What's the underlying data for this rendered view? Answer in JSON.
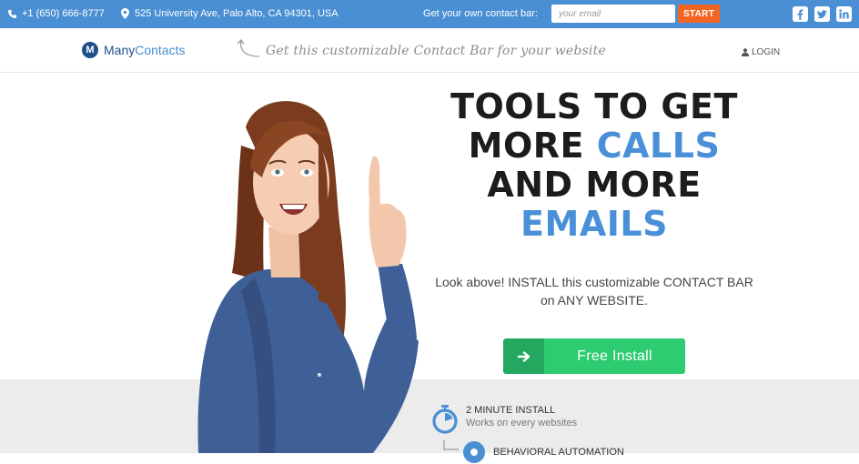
{
  "contact_bar": {
    "phone": "+1 (650) 666-8777",
    "address": "525 University Ave, Palo Alto, CA 94301, USA",
    "cta_text": "Get your own contact bar:",
    "email_placeholder": "your email",
    "start_label": "START",
    "social": [
      "facebook-icon",
      "twitter-icon",
      "linkedin-icon"
    ]
  },
  "header": {
    "logo_part1": "Many",
    "logo_part2": "Contacts",
    "tagline": "Get this customizable Contact Bar for your website",
    "login_label": "LOGIN"
  },
  "hero": {
    "headline_line1": "TOOLS TO GET",
    "headline_line2_a": "MORE ",
    "headline_line2_b": "CALLS",
    "headline_line3": "AND MORE",
    "headline_line4": "EMAILS",
    "subline": "Look above! INSTALL this customizable CONTACT BAR on ANY WEBSITE.",
    "install_label": "Free Install"
  },
  "features": [
    {
      "title": "2 MINUTE INSTALL",
      "desc": "Works on every websites"
    },
    {
      "title": "BEHAVIORAL AUTOMATION",
      "desc": ""
    }
  ],
  "colors": {
    "bar_blue": "#4a8fd3",
    "start_orange": "#f26522",
    "install_green": "#2ecc71",
    "headline_blue": "#4a90d9"
  }
}
